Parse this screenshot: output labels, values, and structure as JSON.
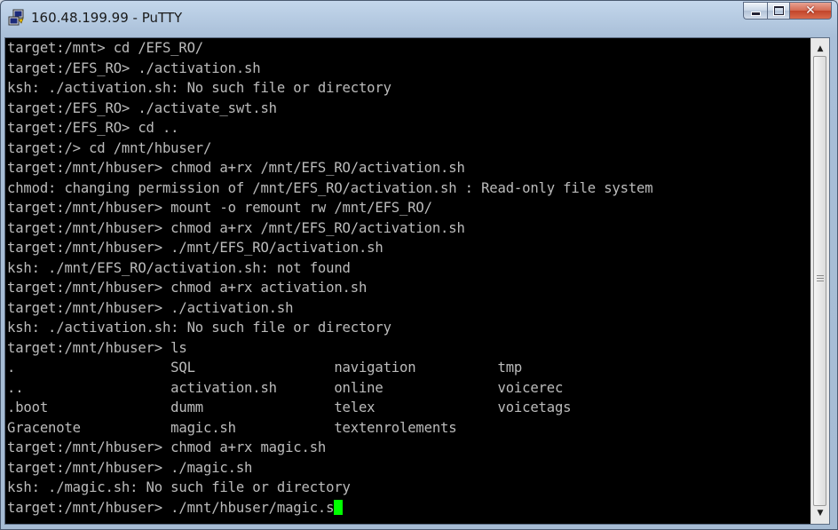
{
  "window": {
    "title": "160.48.199.99 - PuTTY"
  },
  "colors": {
    "terminal_bg": "#000000",
    "terminal_fg": "#bbbbbb",
    "cursor": "#00ff00",
    "close_button": "#c2452a"
  },
  "icons": {
    "app": "putty-icon",
    "minimize": "minimize-icon",
    "maximize": "maximize-icon",
    "close": "close-icon",
    "scroll_up": "arrow-up-icon",
    "scroll_down": "arrow-down-icon",
    "scroll_grip": "grip-icon"
  },
  "scrollbar": {
    "up_glyph": "▲",
    "down_glyph": "▼"
  },
  "terminal": {
    "lines": [
      "target:/mnt> cd /EFS_RO/",
      "target:/EFS_RO> ./activation.sh",
      "ksh: ./activation.sh: No such file or directory",
      "target:/EFS_RO> ./activate_swt.sh",
      "target:/EFS_RO> cd ..",
      "target:/> cd /mnt/hbuser/",
      "target:/mnt/hbuser> chmod a+rx /mnt/EFS_RO/activation.sh",
      "chmod: changing permission of /mnt/EFS_RO/activation.sh : Read-only file system",
      "target:/mnt/hbuser> mount -o remount rw /mnt/EFS_RO/",
      "target:/mnt/hbuser> chmod a+rx /mnt/EFS_RO/activation.sh",
      "target:/mnt/hbuser> ./mnt/EFS_RO/activation.sh",
      "ksh: ./mnt/EFS_RO/activation.sh: not found",
      "target:/mnt/hbuser> chmod a+rx activation.sh",
      "target:/mnt/hbuser> ./activation.sh",
      "ksh: ./activation.sh: No such file or directory",
      "target:/mnt/hbuser> ls",
      ".                   SQL                 navigation          tmp",
      "..                  activation.sh       online              voicerec",
      ".boot               dumm                telex               voicetags",
      "Gracenote           magic.sh            textenrolements",
      "target:/mnt/hbuser> chmod a+rx magic.sh",
      "target:/mnt/hbuser> ./magic.sh",
      "ksh: ./magic.sh: No such file or directory"
    ],
    "current_input": "target:/mnt/hbuser> ./mnt/hbuser/magic.s"
  }
}
